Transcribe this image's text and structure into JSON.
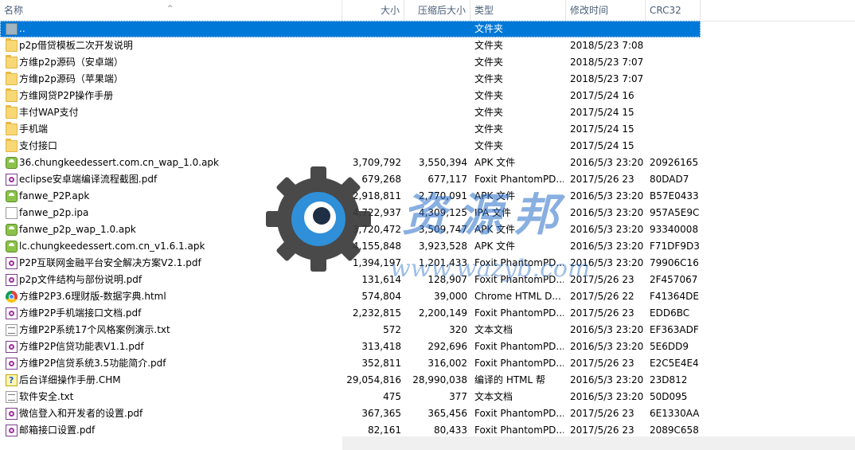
{
  "headers": {
    "name": "名称",
    "size": "大小",
    "compressed": "压缩后大小",
    "type": "类型",
    "modified": "修改时间",
    "crc": "CRC32"
  },
  "sort_indicator": "^",
  "rows": [
    {
      "name": "..",
      "size": "",
      "csize": "",
      "type": "文件夹",
      "date": "",
      "crc": "",
      "icon": "up-folder-icon",
      "selected": true
    },
    {
      "name": "p2p借贷模板二次开发说明",
      "size": "",
      "csize": "",
      "type": "文件夹",
      "date": "2018/5/23 7:08",
      "crc": "",
      "icon": "folder-icon"
    },
    {
      "name": "方维p2p源码（安卓端）",
      "size": "",
      "csize": "",
      "type": "文件夹",
      "date": "2018/5/23 7:07",
      "crc": "",
      "icon": "folder-icon"
    },
    {
      "name": "方维p2p源码（苹果端）",
      "size": "",
      "csize": "",
      "type": "文件夹",
      "date": "2018/5/23 7:07",
      "crc": "",
      "icon": "folder-icon"
    },
    {
      "name": "方维网贷P2P操作手册",
      "size": "",
      "csize": "",
      "type": "文件夹",
      "date": "2017/5/24 16",
      "crc": "",
      "icon": "folder-icon"
    },
    {
      "name": "丰付WAP支付",
      "size": "",
      "csize": "",
      "type": "文件夹",
      "date": "2017/5/24 15",
      "crc": "",
      "icon": "folder-icon"
    },
    {
      "name": "手机端",
      "size": "",
      "csize": "",
      "type": "文件夹",
      "date": "2017/5/24 15",
      "crc": "",
      "icon": "folder-icon"
    },
    {
      "name": "支付接口",
      "size": "",
      "csize": "",
      "type": "文件夹",
      "date": "2017/5/24 15",
      "crc": "",
      "icon": "folder-icon"
    },
    {
      "name": "36.chungkeedessert.com.cn_wap_1.0.apk",
      "size": "3,709,792",
      "csize": "3,550,394",
      "type": "APK 文件",
      "date": "2016/5/3 23:20",
      "crc": "20926165",
      "icon": "apk-icon"
    },
    {
      "name": "eclipse安卓端编译流程截图.pdf",
      "size": "679,268",
      "csize": "677,117",
      "type": "Foxit PhantomPD...",
      "date": "2017/5/26 23",
      "crc": "80DAD7",
      "icon": "pdf-icon"
    },
    {
      "name": "fanwe_P2P.apk",
      "size": "2,918,811",
      "csize": "2,770,091",
      "type": "APK 文件",
      "date": "2016/5/3 23:20",
      "crc": "B57E0433",
      "icon": "apk-icon"
    },
    {
      "name": "fanwe_p2p.ipa",
      "size": "4,722,937",
      "csize": "4,309,125",
      "type": "IPA 文件",
      "date": "2016/5/3 23:20",
      "crc": "957A5E9C",
      "icon": "file-icon"
    },
    {
      "name": "fanwe_p2p_wap_1.0.apk",
      "size": "3,720,472",
      "csize": "3,509,747",
      "type": "APK 文件",
      "date": "2016/5/3 23:20",
      "crc": "93340008",
      "icon": "apk-icon"
    },
    {
      "name": "lc.chungkeedessert.com.cn_v1.6.1.apk",
      "size": "4,155,848",
      "csize": "3,923,528",
      "type": "APK 文件",
      "date": "2016/5/3 23:20",
      "crc": "F71DF9D3",
      "icon": "apk-icon"
    },
    {
      "name": "P2P互联网金融平台安全解决方案V2.1.pdf",
      "size": "1,394,197",
      "csize": "1,201,433",
      "type": "Foxit PhantomPD...",
      "date": "2016/5/3 23:20",
      "crc": "79906C16",
      "icon": "pdf-icon"
    },
    {
      "name": "p2p文件结构与部份说明.pdf",
      "size": "131,614",
      "csize": "128,907",
      "type": "Foxit PhantomPD...",
      "date": "2017/5/26 23",
      "crc": "2F457067",
      "icon": "pdf-icon"
    },
    {
      "name": "方维P2P3.6理财版-数据字典.html",
      "size": "574,804",
      "csize": "39,000",
      "type": "Chrome HTML D...",
      "date": "2017/5/26 22",
      "crc": "F41364DE",
      "icon": "chrome-html-icon"
    },
    {
      "name": "方维P2P手机端接口文档.pdf",
      "size": "2,232,815",
      "csize": "2,200,149",
      "type": "Foxit PhantomPD...",
      "date": "2017/5/26 23",
      "crc": "EDD6BC",
      "icon": "pdf-icon"
    },
    {
      "name": "方维P2P系统17个风格案例演示.txt",
      "size": "572",
      "csize": "320",
      "type": "文本文档",
      "date": "2016/5/3 23:20",
      "crc": "EF363ADF",
      "icon": "txt-icon"
    },
    {
      "name": "方维P2P信贷功能表V1.1.pdf",
      "size": "313,418",
      "csize": "292,696",
      "type": "Foxit PhantomPD...",
      "date": "2016/5/3 23:20",
      "crc": "5E6DD9",
      "icon": "pdf-icon"
    },
    {
      "name": "方维P2P信贷系统3.5功能简介.pdf",
      "size": "352,811",
      "csize": "316,002",
      "type": "Foxit PhantomPD...",
      "date": "2017/5/26 23",
      "crc": "E2C5E4E4",
      "icon": "pdf-icon"
    },
    {
      "name": "后台详细操作手册.CHM",
      "size": "29,054,816",
      "csize": "28,990,038",
      "type": "编译的 HTML 帮",
      "date": "2016/5/3 23:20",
      "crc": "23D812",
      "icon": "chm-icon"
    },
    {
      "name": "软件安全.txt",
      "size": "475",
      "csize": "377",
      "type": "文本文档",
      "date": "2016/5/3 23:20",
      "crc": "50D095",
      "icon": "txt-icon"
    },
    {
      "name": "微信登入和开发者的设置.pdf",
      "size": "367,365",
      "csize": "365,456",
      "type": "Foxit PhantomPD...",
      "date": "2017/5/26 23",
      "crc": "6E1330AA",
      "icon": "pdf-icon"
    },
    {
      "name": "邮箱接口设置.pdf",
      "size": "82,161",
      "csize": "80,433",
      "type": "Foxit PhantomPD...",
      "date": "2017/5/26 23",
      "crc": "2089C658",
      "icon": "pdf-icon"
    }
  ],
  "watermark": {
    "title": "资源邦",
    "url": "www.wazyb.com"
  }
}
